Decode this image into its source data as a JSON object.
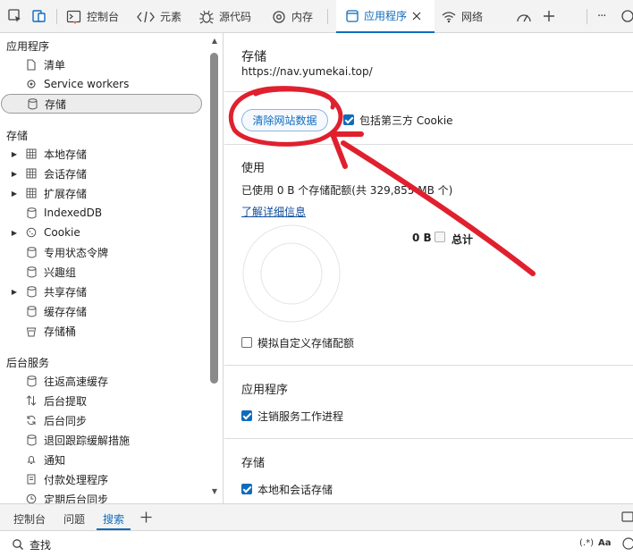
{
  "toolbar": {
    "tabs": [
      {
        "label": "控制台",
        "icon": "terminal-icon"
      },
      {
        "label": "元素",
        "icon": "code-brackets-icon"
      },
      {
        "label": "源代码",
        "icon": "bug-icon"
      },
      {
        "label": "内存",
        "icon": "gear-icon"
      },
      {
        "label": "应用程序",
        "icon": "window-icon",
        "active": true
      },
      {
        "label": "网络",
        "icon": "wifi-icon"
      },
      {
        "label": "",
        "icon": "performance-gauge-icon"
      }
    ],
    "more_label": "···"
  },
  "sidebar": {
    "app_heading": "应用程序",
    "app_items": [
      {
        "label": "清单",
        "icon": "document-icon"
      },
      {
        "label": "Service workers",
        "icon": "gear-icon"
      },
      {
        "label": "存储",
        "icon": "database-icon",
        "selected": true
      }
    ],
    "storage_heading": "存储",
    "storage_items": [
      {
        "label": "本地存储",
        "icon": "grid-icon",
        "expandable": true
      },
      {
        "label": "会话存储",
        "icon": "grid-icon",
        "expandable": true
      },
      {
        "label": "扩展存储",
        "icon": "grid-icon",
        "expandable": true
      },
      {
        "label": "IndexedDB",
        "icon": "database-icon"
      },
      {
        "label": "Cookie",
        "icon": "cookie-icon",
        "expandable": true
      },
      {
        "label": "专用状态令牌",
        "icon": "database-icon"
      },
      {
        "label": "兴趣组",
        "icon": "database-icon"
      },
      {
        "label": "共享存储",
        "icon": "database-icon",
        "expandable": true
      },
      {
        "label": "缓存存储",
        "icon": "database-icon"
      },
      {
        "label": "存储桶",
        "icon": "bucket-icon"
      }
    ],
    "bg_heading": "后台服务",
    "bg_items": [
      {
        "label": "往返高速缓存",
        "icon": "database-icon"
      },
      {
        "label": "后台提取",
        "icon": "up-down-arrows-icon"
      },
      {
        "label": "后台同步",
        "icon": "sync-icon"
      },
      {
        "label": "退回跟踪缓解措施",
        "icon": "database-icon"
      },
      {
        "label": "通知",
        "icon": "bell-icon"
      },
      {
        "label": "付款处理程序",
        "icon": "card-icon"
      },
      {
        "label": "定期后台同步",
        "icon": "clock-icon"
      }
    ]
  },
  "main": {
    "title": "存储",
    "url": "https://nav.yumekai.top/",
    "clear_button": "清除网站数据",
    "include_third_party": "包括第三方 Cookie",
    "include_third_party_checked": true,
    "usage_title": "使用",
    "usage_text": "已使用 0 B 个存储配额(共 329,855 MB 个)",
    "learn_more": "了解详细信息",
    "total_value": "0 B",
    "total_label": "总计",
    "simulate_label": "模拟自定义存储配额",
    "simulate_checked": false,
    "app_section_title": "应用程序",
    "unregister_label": "注销服务工作进程",
    "unregister_checked": true,
    "storage_section_title": "存储",
    "local_session_label": "本地和会话存储",
    "local_session_checked": true
  },
  "bottom": {
    "tabs": [
      {
        "label": "控制台"
      },
      {
        "label": "问题"
      },
      {
        "label": "搜索",
        "active": true
      }
    ],
    "add_label": "+",
    "search_placeholder": "查找",
    "regex_label": "(.*)",
    "case_label": "Aa"
  },
  "colors": {
    "accent": "#0f6cbd",
    "annotation": "#e0202e"
  }
}
